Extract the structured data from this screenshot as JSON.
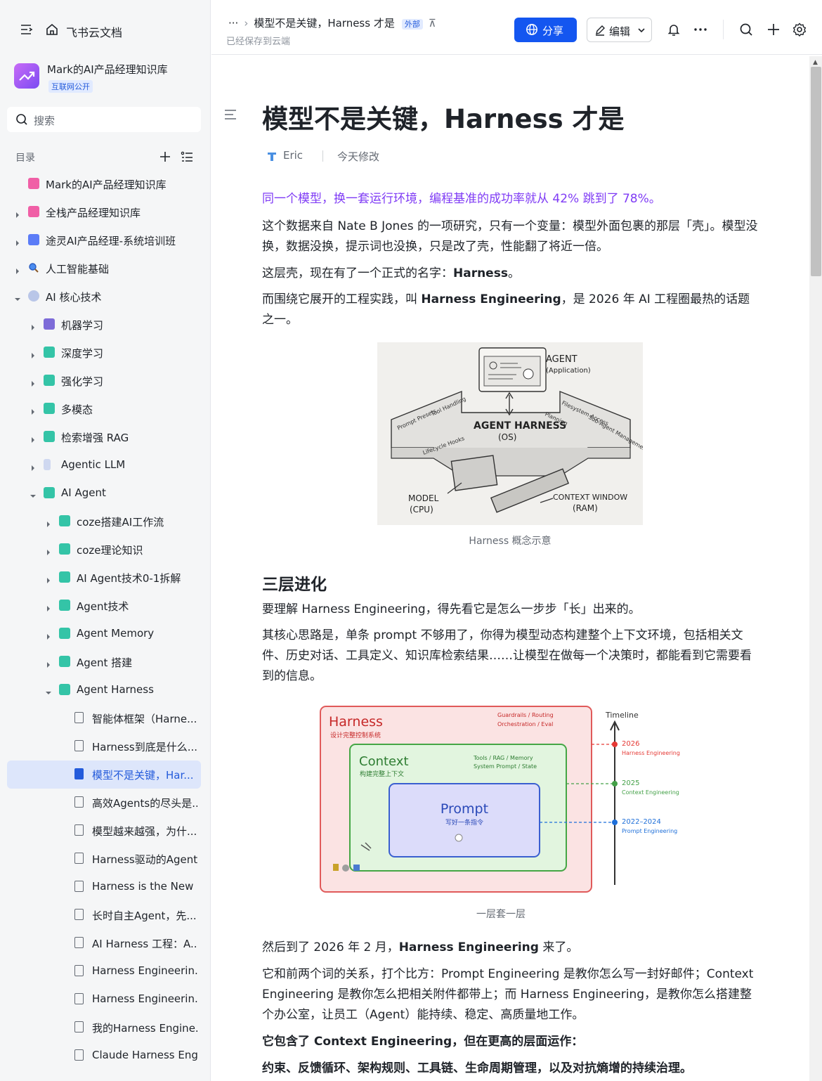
{
  "sidebar": {
    "brand": "飞书云文档",
    "kb_title": "Mark的AI产品经理知识库",
    "kb_badge": "互联网公开",
    "search_placeholder": "搜索",
    "toc_label": "目录",
    "items": [
      {
        "label": "Mark的AI产品经理知识库",
        "level": 0,
        "icon": "kb-icon",
        "arrow": "none"
      },
      {
        "label": "全栈产品经理知识库",
        "level": 0,
        "icon": "kb-icon",
        "arrow": "right"
      },
      {
        "label": "途灵AI产品经理-系统培训班",
        "level": 0,
        "icon": "share-icon",
        "arrow": "right"
      },
      {
        "label": "人工智能基础",
        "level": 0,
        "icon": "magnifier-icon",
        "arrow": "right"
      },
      {
        "label": "AI 核心技术",
        "level": 0,
        "icon": "globe-icon",
        "arrow": "down"
      },
      {
        "label": "机器学习",
        "level": 1,
        "icon": "robot-icon",
        "arrow": "right"
      },
      {
        "label": "深度学习",
        "level": 1,
        "icon": "tag-icon",
        "arrow": "right"
      },
      {
        "label": "强化学习",
        "level": 1,
        "icon": "tag-icon",
        "arrow": "right"
      },
      {
        "label": "多模态",
        "level": 1,
        "icon": "tag-icon",
        "arrow": "right"
      },
      {
        "label": "检索增强 RAG",
        "level": 1,
        "icon": "tag-icon",
        "arrow": "right"
      },
      {
        "label": "Agentic LLM",
        "level": 1,
        "icon": "flask-icon",
        "arrow": "right"
      },
      {
        "label": "AI Agent",
        "level": 1,
        "icon": "tag-icon",
        "arrow": "down"
      },
      {
        "label": "coze搭建AI工作流",
        "level": 2,
        "icon": "tag-icon",
        "arrow": "right"
      },
      {
        "label": "coze理论知识",
        "level": 2,
        "icon": "tag-icon",
        "arrow": "right"
      },
      {
        "label": "AI Agent技术0-1拆解",
        "level": 2,
        "icon": "tag-icon",
        "arrow": "right"
      },
      {
        "label": "Agent技术",
        "level": 2,
        "icon": "tag-icon",
        "arrow": "right"
      },
      {
        "label": "Agent Memory",
        "level": 2,
        "icon": "tag-icon",
        "arrow": "right"
      },
      {
        "label": "Agent 搭建",
        "level": 2,
        "icon": "tag-icon",
        "arrow": "right"
      },
      {
        "label": "Agent Harness",
        "level": 2,
        "icon": "tag-icon",
        "arrow": "down"
      },
      {
        "label": "智能体框架（Harne...",
        "level": 3,
        "icon": "doc-icon",
        "arrow": "none"
      },
      {
        "label": "Harness到底是什么...",
        "level": 3,
        "icon": "doc-icon",
        "arrow": "none"
      },
      {
        "label": "模型不是关键，Har...",
        "level": 3,
        "icon": "doc-icon",
        "arrow": "none",
        "active": true
      },
      {
        "label": "高效Agents的尽头是...",
        "level": 3,
        "icon": "doc-icon",
        "arrow": "none"
      },
      {
        "label": "模型越来越强，为什...",
        "level": 3,
        "icon": "doc-icon",
        "arrow": "none"
      },
      {
        "label": "Harness驱动的Agent",
        "level": 3,
        "icon": "doc-icon",
        "arrow": "none"
      },
      {
        "label": "Harness is the New ...",
        "level": 3,
        "icon": "doc-icon",
        "arrow": "none"
      },
      {
        "label": "长时自主Agent，先...",
        "level": 3,
        "icon": "doc-icon",
        "arrow": "none"
      },
      {
        "label": "AI Harness 工程：A...",
        "level": 3,
        "icon": "doc-icon",
        "arrow": "none"
      },
      {
        "label": "Harness Engineerin...",
        "level": 3,
        "icon": "doc-icon",
        "arrow": "none"
      },
      {
        "label": "Harness Engineerin...",
        "level": 3,
        "icon": "doc-icon",
        "arrow": "none"
      },
      {
        "label": "我的Harness Engine...",
        "level": 3,
        "icon": "doc-icon",
        "arrow": "none"
      },
      {
        "label": "Claude Harness Eng...",
        "level": 3,
        "icon": "doc-icon",
        "arrow": "none"
      }
    ]
  },
  "header": {
    "dots": "···",
    "breadcrumb_title": "模型不是关键，Harness 才是",
    "external_badge": "外部",
    "saved_status": "已经保存到云端",
    "share_label": "分享",
    "edit_label": "编辑"
  },
  "doc": {
    "title": "模型不是关键，Harness 才是",
    "author": "Eric",
    "modified": "今天修改",
    "p1": "同一个模型，换一套运行环境，编程基准的成功率就从 42% 跳到了 78%。",
    "p2": "这个数据来自 Nate B Jones 的一项研究，只有一个变量：模型外面包裹的那层「壳」。模型没换，数据没换，提示词也没换，只是改了壳，性能翻了将近一倍。",
    "p3_a": "这层壳，现在有了一个正式的名字：",
    "p3_b": "Harness",
    "p3_c": "。",
    "p4_a": "而围绕它展开的工程实践，叫 ",
    "p4_b": "Harness Engineering",
    "p4_c": "，是 2026 年 AI 工程圈最热的话题之一。",
    "fig1_caption": "Harness 概念示意",
    "fig1_labels": {
      "agent": "AGENT",
      "agent_sub": "(Application)",
      "harness": "AGENT HARNESS",
      "harness_sub": "(OS)",
      "model": "MODEL",
      "model_sub": "(CPU)",
      "ctx": "CONTEXT WINDOW",
      "ctx_sub": "(RAM)",
      "prompt_presets": "Prompt Presets",
      "tool_handling": "Tool Handling",
      "lifecycle": "Lifecycle Hooks",
      "fs": "Filesystem Access",
      "planning": "Planning",
      "subagent": "Sub-Agent Management"
    },
    "h2": "三层进化",
    "p5": "要理解 Harness Engineering，得先看它是怎么一步步「长」出来的。",
    "p6": "其核心思路是，单条 prompt 不够用了，你得为模型动态构建整个上下文环境，包括相关文件、历史对话、工具定义、知识库检索结果……让模型在做每一个决策时，都能看到它需要看到的信息。",
    "fig2_caption": "一层套一层",
    "fig2_labels": {
      "harness": "Harness",
      "harness_sub": "设计完整控制系统",
      "harness_note1": "Guardrails / Routing",
      "harness_note2": "Orchestration / Eval",
      "context": "Context",
      "context_sub": "构建完整上下文",
      "context_note1": "Tools / RAG / Memory",
      "context_note2": "System Prompt / State",
      "prompt": "Prompt",
      "prompt_sub": "写好一条指令",
      "timeline": "Timeline",
      "t2026": "2026",
      "t2026_sub": "Harness Engineering",
      "t2025": "2025",
      "t2025_sub": "Context Engineering",
      "t2022": "2022–2024",
      "t2022_sub": "Prompt Engineering"
    },
    "p7_a": "然后到了 2026 年 2 月，",
    "p7_b": "Harness Engineering",
    "p7_c": " 来了。",
    "p8": "它和前两个词的关系，打个比方：Prompt Engineering 是教你怎么写一封好邮件；Context Engineering 是教你怎么把相关附件都带上；而 Harness Engineering，是教你怎么搭建整个办公室，让员工（Agent）能持续、稳定、高质量地工作。",
    "p9": "它包含了 Context Engineering，但在更高的层面运作：",
    "p10": "约束、反馈循环、架构规则、工具链、生命周期管理，以及对抗熵增的持续治理。"
  },
  "colors": {
    "accent": "#1456f0",
    "highlight_text": "#7f3bf5",
    "active_nav_bg": "#dde6fb"
  }
}
